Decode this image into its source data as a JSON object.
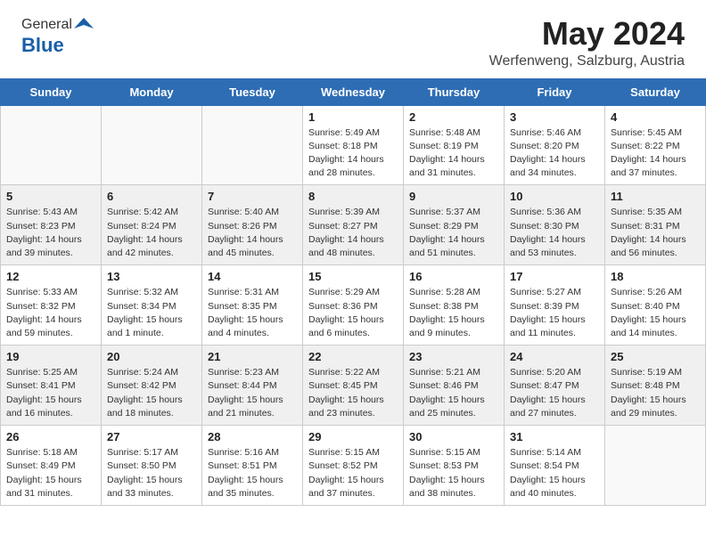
{
  "header": {
    "logo_general": "General",
    "logo_blue": "Blue",
    "title": "May 2024",
    "subtitle": "Werfenweng, Salzburg, Austria"
  },
  "days_of_week": [
    "Sunday",
    "Monday",
    "Tuesday",
    "Wednesday",
    "Thursday",
    "Friday",
    "Saturday"
  ],
  "weeks": [
    [
      {
        "day": "",
        "info": []
      },
      {
        "day": "",
        "info": []
      },
      {
        "day": "",
        "info": []
      },
      {
        "day": "1",
        "info": [
          "Sunrise: 5:49 AM",
          "Sunset: 8:18 PM",
          "Daylight: 14 hours",
          "and 28 minutes."
        ]
      },
      {
        "day": "2",
        "info": [
          "Sunrise: 5:48 AM",
          "Sunset: 8:19 PM",
          "Daylight: 14 hours",
          "and 31 minutes."
        ]
      },
      {
        "day": "3",
        "info": [
          "Sunrise: 5:46 AM",
          "Sunset: 8:20 PM",
          "Daylight: 14 hours",
          "and 34 minutes."
        ]
      },
      {
        "day": "4",
        "info": [
          "Sunrise: 5:45 AM",
          "Sunset: 8:22 PM",
          "Daylight: 14 hours",
          "and 37 minutes."
        ]
      }
    ],
    [
      {
        "day": "5",
        "info": [
          "Sunrise: 5:43 AM",
          "Sunset: 8:23 PM",
          "Daylight: 14 hours",
          "and 39 minutes."
        ]
      },
      {
        "day": "6",
        "info": [
          "Sunrise: 5:42 AM",
          "Sunset: 8:24 PM",
          "Daylight: 14 hours",
          "and 42 minutes."
        ]
      },
      {
        "day": "7",
        "info": [
          "Sunrise: 5:40 AM",
          "Sunset: 8:26 PM",
          "Daylight: 14 hours",
          "and 45 minutes."
        ]
      },
      {
        "day": "8",
        "info": [
          "Sunrise: 5:39 AM",
          "Sunset: 8:27 PM",
          "Daylight: 14 hours",
          "and 48 minutes."
        ]
      },
      {
        "day": "9",
        "info": [
          "Sunrise: 5:37 AM",
          "Sunset: 8:29 PM",
          "Daylight: 14 hours",
          "and 51 minutes."
        ]
      },
      {
        "day": "10",
        "info": [
          "Sunrise: 5:36 AM",
          "Sunset: 8:30 PM",
          "Daylight: 14 hours",
          "and 53 minutes."
        ]
      },
      {
        "day": "11",
        "info": [
          "Sunrise: 5:35 AM",
          "Sunset: 8:31 PM",
          "Daylight: 14 hours",
          "and 56 minutes."
        ]
      }
    ],
    [
      {
        "day": "12",
        "info": [
          "Sunrise: 5:33 AM",
          "Sunset: 8:32 PM",
          "Daylight: 14 hours",
          "and 59 minutes."
        ]
      },
      {
        "day": "13",
        "info": [
          "Sunrise: 5:32 AM",
          "Sunset: 8:34 PM",
          "Daylight: 15 hours",
          "and 1 minute."
        ]
      },
      {
        "day": "14",
        "info": [
          "Sunrise: 5:31 AM",
          "Sunset: 8:35 PM",
          "Daylight: 15 hours",
          "and 4 minutes."
        ]
      },
      {
        "day": "15",
        "info": [
          "Sunrise: 5:29 AM",
          "Sunset: 8:36 PM",
          "Daylight: 15 hours",
          "and 6 minutes."
        ]
      },
      {
        "day": "16",
        "info": [
          "Sunrise: 5:28 AM",
          "Sunset: 8:38 PM",
          "Daylight: 15 hours",
          "and 9 minutes."
        ]
      },
      {
        "day": "17",
        "info": [
          "Sunrise: 5:27 AM",
          "Sunset: 8:39 PM",
          "Daylight: 15 hours",
          "and 11 minutes."
        ]
      },
      {
        "day": "18",
        "info": [
          "Sunrise: 5:26 AM",
          "Sunset: 8:40 PM",
          "Daylight: 15 hours",
          "and 14 minutes."
        ]
      }
    ],
    [
      {
        "day": "19",
        "info": [
          "Sunrise: 5:25 AM",
          "Sunset: 8:41 PM",
          "Daylight: 15 hours",
          "and 16 minutes."
        ]
      },
      {
        "day": "20",
        "info": [
          "Sunrise: 5:24 AM",
          "Sunset: 8:42 PM",
          "Daylight: 15 hours",
          "and 18 minutes."
        ]
      },
      {
        "day": "21",
        "info": [
          "Sunrise: 5:23 AM",
          "Sunset: 8:44 PM",
          "Daylight: 15 hours",
          "and 21 minutes."
        ]
      },
      {
        "day": "22",
        "info": [
          "Sunrise: 5:22 AM",
          "Sunset: 8:45 PM",
          "Daylight: 15 hours",
          "and 23 minutes."
        ]
      },
      {
        "day": "23",
        "info": [
          "Sunrise: 5:21 AM",
          "Sunset: 8:46 PM",
          "Daylight: 15 hours",
          "and 25 minutes."
        ]
      },
      {
        "day": "24",
        "info": [
          "Sunrise: 5:20 AM",
          "Sunset: 8:47 PM",
          "Daylight: 15 hours",
          "and 27 minutes."
        ]
      },
      {
        "day": "25",
        "info": [
          "Sunrise: 5:19 AM",
          "Sunset: 8:48 PM",
          "Daylight: 15 hours",
          "and 29 minutes."
        ]
      }
    ],
    [
      {
        "day": "26",
        "info": [
          "Sunrise: 5:18 AM",
          "Sunset: 8:49 PM",
          "Daylight: 15 hours",
          "and 31 minutes."
        ]
      },
      {
        "day": "27",
        "info": [
          "Sunrise: 5:17 AM",
          "Sunset: 8:50 PM",
          "Daylight: 15 hours",
          "and 33 minutes."
        ]
      },
      {
        "day": "28",
        "info": [
          "Sunrise: 5:16 AM",
          "Sunset: 8:51 PM",
          "Daylight: 15 hours",
          "and 35 minutes."
        ]
      },
      {
        "day": "29",
        "info": [
          "Sunrise: 5:15 AM",
          "Sunset: 8:52 PM",
          "Daylight: 15 hours",
          "and 37 minutes."
        ]
      },
      {
        "day": "30",
        "info": [
          "Sunrise: 5:15 AM",
          "Sunset: 8:53 PM",
          "Daylight: 15 hours",
          "and 38 minutes."
        ]
      },
      {
        "day": "31",
        "info": [
          "Sunrise: 5:14 AM",
          "Sunset: 8:54 PM",
          "Daylight: 15 hours",
          "and 40 minutes."
        ]
      },
      {
        "day": "",
        "info": []
      }
    ]
  ],
  "shaded_rows": [
    1,
    3
  ]
}
